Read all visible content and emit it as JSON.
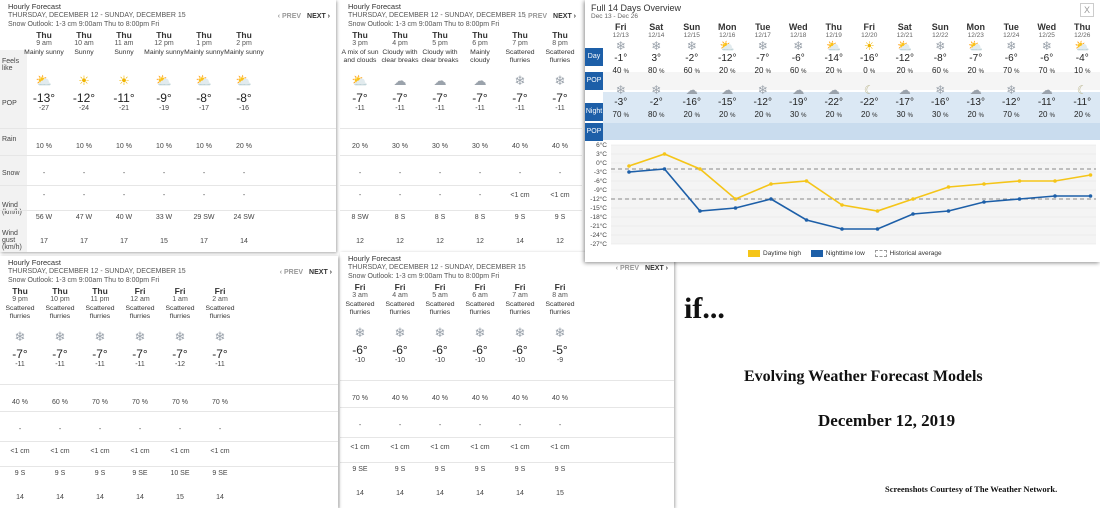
{
  "panel_header": {
    "title": "Hourly Forecast",
    "range": "THURSDAY, DECEMBER 12 - SUNDAY, DECEMBER 15",
    "outlook": "Snow Outlook: 1-3 cm 9:00am Thu to 8:00pm Fri",
    "prev": "‹ PREV",
    "next": "NEXT ›"
  },
  "row_labels": {
    "feels": "Feels like",
    "pop": "POP",
    "rain": "Rain",
    "snow": "Snow",
    "wind": "Wind (km/h)",
    "gust": "Wind gust (km/h)"
  },
  "panel1": [
    {
      "day": "Thu",
      "time": "9 am",
      "cond": "Mainly sunny",
      "icon": "sun-cloud-icon",
      "temp": "-13°",
      "feels": "-27",
      "pop": "10 %",
      "snow": "-",
      "snow2": "-",
      "wind": "56 W",
      "gust": "17"
    },
    {
      "day": "Thu",
      "time": "10 am",
      "cond": "Sunny",
      "icon": "sun-icon",
      "temp": "-12°",
      "feels": "-24",
      "pop": "10 %",
      "snow": "-",
      "snow2": "-",
      "wind": "47 W",
      "gust": "17"
    },
    {
      "day": "Thu",
      "time": "11 am",
      "cond": "Sunny",
      "icon": "sun-icon",
      "temp": "-11°",
      "feels": "-21",
      "pop": "10 %",
      "snow": "-",
      "snow2": "-",
      "wind": "40 W",
      "gust": "17"
    },
    {
      "day": "Thu",
      "time": "12 pm",
      "cond": "Mainly sunny",
      "icon": "sun-cloud-icon",
      "temp": "-9°",
      "feels": "-19",
      "pop": "10 %",
      "snow": "-",
      "snow2": "-",
      "wind": "33 W",
      "gust": "15"
    },
    {
      "day": "Thu",
      "time": "1 pm",
      "cond": "Mainly sunny",
      "icon": "sun-cloud-icon",
      "temp": "-8°",
      "feels": "-17",
      "pop": "10 %",
      "snow": "-",
      "snow2": "-",
      "wind": "29 SW",
      "gust": "17"
    },
    {
      "day": "Thu",
      "time": "2 pm",
      "cond": "Mainly sunny",
      "icon": "sun-cloud-icon",
      "temp": "-8°",
      "feels": "-16",
      "pop": "20 %",
      "snow": "-",
      "snow2": "-",
      "wind": "24 SW",
      "gust": "14"
    }
  ],
  "panel2": [
    {
      "day": "Thu",
      "time": "3 pm",
      "cond": "A mix of sun and clouds",
      "icon": "sun-cloud-icon",
      "temp": "-7°",
      "feels": "-11",
      "pop": "20 %",
      "snow": "-",
      "snow2": "-",
      "wind": "8 SW",
      "gust": "12"
    },
    {
      "day": "Thu",
      "time": "4 pm",
      "cond": "Cloudy with clear breaks",
      "icon": "cloud-icon",
      "temp": "-7°",
      "feels": "-11",
      "pop": "30 %",
      "snow": "-",
      "snow2": "-",
      "wind": "8 S",
      "gust": "12"
    },
    {
      "day": "Thu",
      "time": "5 pm",
      "cond": "Cloudy with clear breaks",
      "icon": "cloud-icon",
      "temp": "-7°",
      "feels": "-11",
      "pop": "30 %",
      "snow": "-",
      "snow2": "-",
      "wind": "8 S",
      "gust": "12"
    },
    {
      "day": "Thu",
      "time": "6 pm",
      "cond": "Mainly cloudy",
      "icon": "cloud-icon",
      "temp": "-7°",
      "feels": "-11",
      "pop": "30 %",
      "snow": "-",
      "snow2": "-",
      "wind": "8 S",
      "gust": "12"
    },
    {
      "day": "Thu",
      "time": "7 pm",
      "cond": "Scattered flurries",
      "icon": "snow-cloud-icon",
      "temp": "-7°",
      "feels": "-11",
      "pop": "40 %",
      "snow": "-",
      "snow2": "<1 cm",
      "wind": "9 S",
      "gust": "14"
    },
    {
      "day": "Thu",
      "time": "8 pm",
      "cond": "Scattered flurries",
      "icon": "snow-cloud-icon",
      "temp": "-7°",
      "feels": "-11",
      "pop": "40 %",
      "snow": "-",
      "snow2": "<1 cm",
      "wind": "9 S",
      "gust": "12"
    }
  ],
  "panel3": [
    {
      "day": "Thu",
      "time": "9 pm",
      "cond": "Scattered flurries",
      "icon": "snow-cloud-icon",
      "temp": "-7°",
      "feels": "-11",
      "pop": "40 %",
      "snow": "-",
      "snow2": "<1 cm",
      "wind": "9 S",
      "gust": "14"
    },
    {
      "day": "Thu",
      "time": "10 pm",
      "cond": "Scattered flurries",
      "icon": "snow-cloud-icon",
      "temp": "-7°",
      "feels": "-11",
      "pop": "60 %",
      "snow": "-",
      "snow2": "<1 cm",
      "wind": "9 S",
      "gust": "14"
    },
    {
      "day": "Thu",
      "time": "11 pm",
      "cond": "Scattered flurries",
      "icon": "snow-cloud-icon",
      "temp": "-7°",
      "feels": "-11",
      "pop": "70 %",
      "snow": "-",
      "snow2": "<1 cm",
      "wind": "9 S",
      "gust": "14"
    },
    {
      "day": "Fri",
      "time": "12 am",
      "cond": "Scattered flurries",
      "icon": "snow-cloud-icon",
      "temp": "-7°",
      "feels": "-11",
      "pop": "70 %",
      "snow": "-",
      "snow2": "<1 cm",
      "wind": "9 SE",
      "gust": "14"
    },
    {
      "day": "Fri",
      "time": "1 am",
      "cond": "Scattered flurries",
      "icon": "snow-cloud-icon",
      "temp": "-7°",
      "feels": "-12",
      "pop": "70 %",
      "snow": "-",
      "snow2": "<1 cm",
      "wind": "10 SE",
      "gust": "15"
    },
    {
      "day": "Fri",
      "time": "2 am",
      "cond": "Scattered flurries",
      "icon": "snow-cloud-icon",
      "temp": "-7°",
      "feels": "-11",
      "pop": "70 %",
      "snow": "-",
      "snow2": "<1 cm",
      "wind": "9 SE",
      "gust": "14"
    }
  ],
  "panel4": [
    {
      "day": "Fri",
      "time": "3 am",
      "cond": "Scattered flurries",
      "icon": "snow-cloud-icon",
      "temp": "-6°",
      "feels": "-10",
      "pop": "70 %",
      "snow": "-",
      "snow2": "<1 cm",
      "wind": "9 SE",
      "gust": "14"
    },
    {
      "day": "Fri",
      "time": "4 am",
      "cond": "Scattered flurries",
      "icon": "snow-cloud-icon",
      "temp": "-6°",
      "feels": "-10",
      "pop": "40 %",
      "snow": "-",
      "snow2": "<1 cm",
      "wind": "9 S",
      "gust": "14"
    },
    {
      "day": "Fri",
      "time": "5 am",
      "cond": "Scattered flurries",
      "icon": "snow-cloud-icon",
      "temp": "-6°",
      "feels": "-10",
      "pop": "40 %",
      "snow": "-",
      "snow2": "<1 cm",
      "wind": "9 S",
      "gust": "14"
    },
    {
      "day": "Fri",
      "time": "6 am",
      "cond": "Scattered flurries",
      "icon": "snow-cloud-icon",
      "temp": "-6°",
      "feels": "-10",
      "pop": "40 %",
      "snow": "-",
      "snow2": "<1 cm",
      "wind": "9 S",
      "gust": "14"
    },
    {
      "day": "Fri",
      "time": "7 am",
      "cond": "Scattered flurries",
      "icon": "snow-cloud-icon",
      "temp": "-6°",
      "feels": "-10",
      "pop": "40 %",
      "snow": "-",
      "snow2": "<1 cm",
      "wind": "9 S",
      "gust": "14"
    },
    {
      "day": "Fri",
      "time": "8 am",
      "cond": "Scattered flurries",
      "icon": "snow-cloud-icon",
      "temp": "-5°",
      "feels": "-9",
      "pop": "40 %",
      "snow": "-",
      "snow2": "<1 cm",
      "wind": "9 S",
      "gust": "15"
    }
  ],
  "overview": {
    "title": "Full 14 Days Overview",
    "range": "Dec 13 - Dec 26",
    "close": "X",
    "day_label": "Day",
    "night_label": "Night",
    "pop_label": "POP",
    "days": [
      {
        "d": "Fri",
        "dt": "12/13",
        "day_icon": "snow-cloud-icon",
        "hi": "-1°",
        "pop_d": "40",
        "night_icon": "snow-cloud-icon",
        "lo": "-3°",
        "pop_n": "70"
      },
      {
        "d": "Sat",
        "dt": "12/14",
        "day_icon": "snow-cloud-icon",
        "hi": "3°",
        "pop_d": "80",
        "night_icon": "snow-cloud-icon",
        "lo": "-2°",
        "pop_n": "80"
      },
      {
        "d": "Sun",
        "dt": "12/15",
        "day_icon": "snow-cloud-icon",
        "hi": "-2°",
        "pop_d": "60",
        "night_icon": "cloud-icon",
        "lo": "-16°",
        "pop_n": "20"
      },
      {
        "d": "Mon",
        "dt": "12/16",
        "day_icon": "sun-cloud-icon",
        "hi": "-12°",
        "pop_d": "20",
        "night_icon": "cloud-icon",
        "lo": "-15°",
        "pop_n": "20"
      },
      {
        "d": "Tue",
        "dt": "12/17",
        "day_icon": "snow-cloud-icon",
        "hi": "-7°",
        "pop_d": "20",
        "night_icon": "snow-cloud-icon",
        "lo": "-12°",
        "pop_n": "20"
      },
      {
        "d": "Wed",
        "dt": "12/18",
        "day_icon": "snow-cloud-icon",
        "hi": "-6°",
        "pop_d": "60",
        "night_icon": "cloud-icon",
        "lo": "-19°",
        "pop_n": "30"
      },
      {
        "d": "Thu",
        "dt": "12/19",
        "day_icon": "sun-cloud-icon",
        "hi": "-14°",
        "pop_d": "20",
        "night_icon": "cloud-icon",
        "lo": "-22°",
        "pop_n": "20"
      },
      {
        "d": "Fri",
        "dt": "12/20",
        "day_icon": "sun-icon",
        "hi": "-16°",
        "pop_d": "0",
        "night_icon": "moon-icon",
        "lo": "-22°",
        "pop_n": "20"
      },
      {
        "d": "Sat",
        "dt": "12/21",
        "day_icon": "sun-cloud-icon",
        "hi": "-12°",
        "pop_d": "20",
        "night_icon": "cloud-icon",
        "lo": "-17°",
        "pop_n": "30"
      },
      {
        "d": "Sun",
        "dt": "12/22",
        "day_icon": "snow-cloud-icon",
        "hi": "-8°",
        "pop_d": "60",
        "night_icon": "snow-cloud-icon",
        "lo": "-16°",
        "pop_n": "30"
      },
      {
        "d": "Mon",
        "dt": "12/23",
        "day_icon": "sun-cloud-icon",
        "hi": "-7°",
        "pop_d": "20",
        "night_icon": "cloud-icon",
        "lo": "-13°",
        "pop_n": "20"
      },
      {
        "d": "Tue",
        "dt": "12/24",
        "day_icon": "snow-cloud-icon",
        "hi": "-6°",
        "pop_d": "70",
        "night_icon": "snow-cloud-icon",
        "lo": "-12°",
        "pop_n": "70"
      },
      {
        "d": "Wed",
        "dt": "12/25",
        "day_icon": "snow-cloud-icon",
        "hi": "-6°",
        "pop_d": "70",
        "night_icon": "cloud-icon",
        "lo": "-11°",
        "pop_n": "20"
      },
      {
        "d": "Thu",
        "dt": "12/26",
        "day_icon": "sun-cloud-icon",
        "hi": "-4°",
        "pop_d": "10",
        "night_icon": "moon-icon",
        "lo": "-11°",
        "pop_n": "20"
      }
    ],
    "pct": "%"
  },
  "chart_data": {
    "type": "line",
    "x": [
      "12/13",
      "12/14",
      "12/15",
      "12/16",
      "12/17",
      "12/18",
      "12/19",
      "12/20",
      "12/21",
      "12/22",
      "12/23",
      "12/24",
      "12/25",
      "12/26"
    ],
    "series": [
      {
        "name": "Daytime high",
        "color": "#f5c518",
        "values": [
          -1,
          3,
          -2,
          -12,
          -7,
          -6,
          -14,
          -16,
          -12,
          -8,
          -7,
          -6,
          -6,
          -4
        ]
      },
      {
        "name": "Nighttime low",
        "color": "#1d5fa8",
        "values": [
          -3,
          -2,
          -16,
          -15,
          -12,
          -19,
          -22,
          -22,
          -17,
          -16,
          -13,
          -12,
          -11,
          -11
        ]
      }
    ],
    "historical_average": {
      "name": "Historical average",
      "high": -2,
      "low": -12
    },
    "yticks": [
      "6°C",
      "3°C",
      "0°C",
      "-3°C",
      "-6°C",
      "-9°C",
      "-12°C",
      "-15°C",
      "-18°C",
      "-21°C",
      "-24°C",
      "-27°C"
    ],
    "ylim": [
      -27,
      6
    ],
    "legend": "bottom"
  },
  "caption": {
    "if": "if...",
    "subtitle": "Evolving Weather Forecast Models",
    "date": "December 12, 2019",
    "credit": "Screenshots Courtesy of The Weather Network."
  }
}
